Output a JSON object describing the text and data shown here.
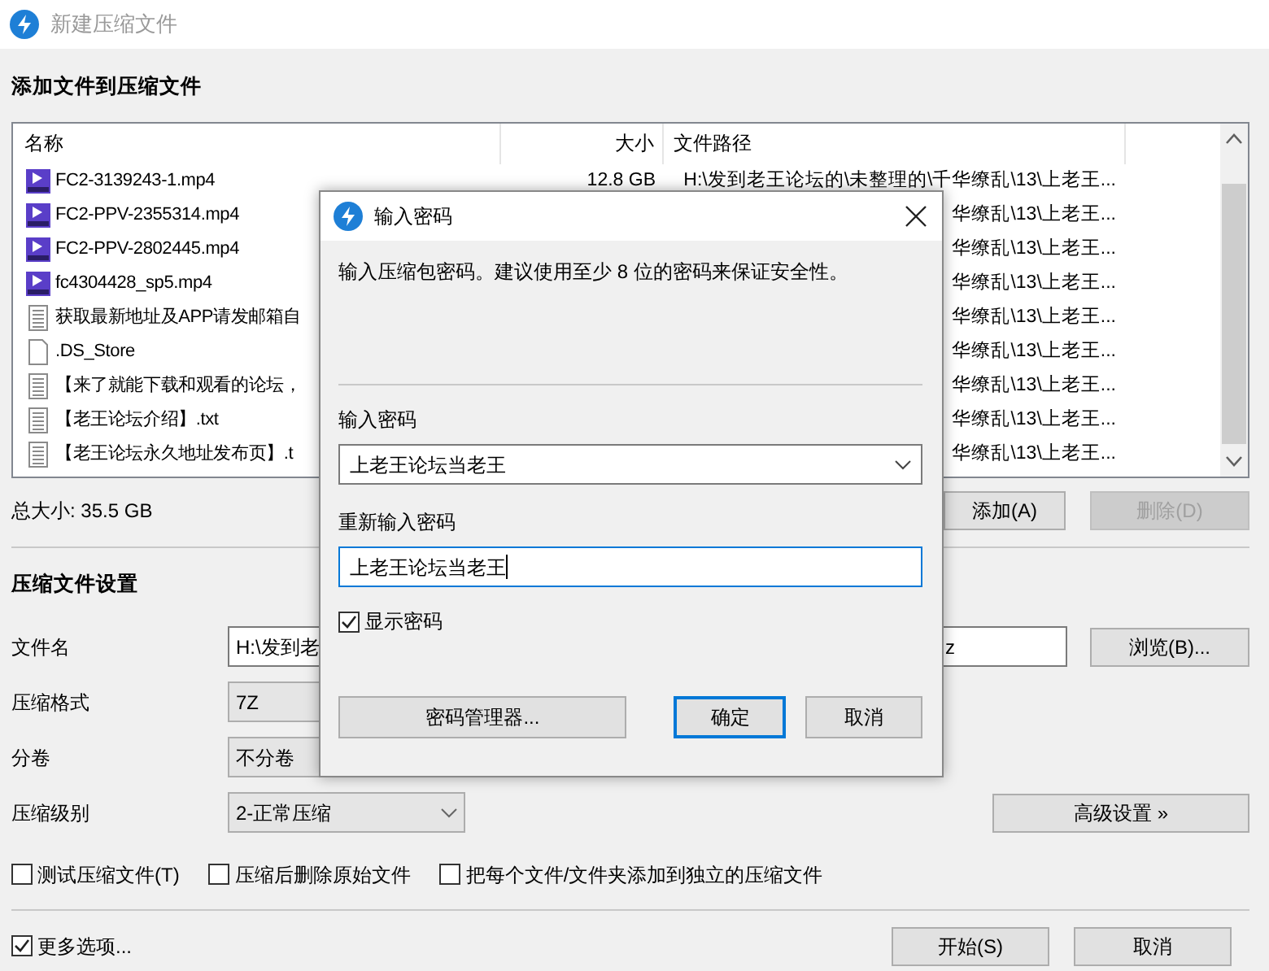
{
  "window": {
    "title": "新建压缩文件"
  },
  "section_title": "添加文件到压缩文件",
  "file_list": {
    "columns": [
      "名称",
      "大小",
      "文件路径"
    ],
    "rows": [
      {
        "name": "FC2-3139243-1.mp4",
        "kind": "video",
        "size": "12.8 GB",
        "path": "H:\\发到老王论坛的\\未整理的\\千华缭乱\\13\\上老王..."
      },
      {
        "name": "FC2-PPV-2355314.mp4",
        "kind": "video",
        "path": "华缭乱\\13\\上老王..."
      },
      {
        "name": "FC2-PPV-2802445.mp4",
        "kind": "video",
        "path": "华缭乱\\13\\上老王..."
      },
      {
        "name": "fc4304428_sp5.mp4",
        "kind": "video",
        "path": "华缭乱\\13\\上老王..."
      },
      {
        "name": "获取最新地址及APP请发邮箱自",
        "kind": "text",
        "path": "华缭乱\\13\\上老王..."
      },
      {
        "name": ".DS_Store",
        "kind": "blank",
        "path": "华缭乱\\13\\上老王..."
      },
      {
        "name": "【来了就能下载和观看的论坛，",
        "kind": "text",
        "path": "华缭乱\\13\\上老王..."
      },
      {
        "name": "【老王论坛介绍】.txt",
        "kind": "text",
        "path": "华缭乱\\13\\上老王..."
      },
      {
        "name": "【老王论坛永久地址发布页】.t",
        "kind": "text",
        "path": "华缭乱\\13\\上老王..."
      }
    ]
  },
  "total_size": "总大小: 35.5 GB",
  "list_buttons": [
    {
      "label": "添加(A)",
      "disabled": false
    },
    {
      "label": "删除(D)",
      "disabled": true
    }
  ],
  "settings": {
    "title": "压缩文件设置",
    "fields": [
      {
        "label": "文件名",
        "kind": "text",
        "value": "H:\\发到老",
        "value_end": "z",
        "button": "浏览(B)..."
      },
      {
        "label": "压缩格式",
        "kind": "select",
        "value": "7Z"
      },
      {
        "label": "分卷",
        "kind": "select",
        "value": "不分卷"
      },
      {
        "label": "压缩级别",
        "kind": "select",
        "value": "2-正常压缩",
        "dropdown_arrow": true,
        "button": "高级设置 »"
      }
    ],
    "options": [
      {
        "label": "测试压缩文件(T)",
        "checked": false
      },
      {
        "label": "压缩后删除原始文件",
        "checked": false
      },
      {
        "label": "把每个文件/文件夹添加到独立的压缩文件",
        "checked": false
      }
    ]
  },
  "more_options": {
    "label": "更多选项...",
    "checked": true
  },
  "footer_buttons": [
    "开始(S)",
    "取消"
  ],
  "dialog": {
    "title": "输入密码",
    "message": "输入压缩包密码。建议使用至少 8 位的密码来保证安全性。",
    "password_label": "输入密码",
    "password": "上老王论坛当老王",
    "confirm_label": "重新输入密码",
    "confirm": "上老王论坛当老王",
    "show_password": {
      "label": "显示密码",
      "checked": true
    },
    "buttons": [
      {
        "label": "密码管理器...",
        "default": false
      },
      {
        "label": "确定",
        "default": true
      },
      {
        "label": "取消",
        "default": false
      }
    ]
  }
}
